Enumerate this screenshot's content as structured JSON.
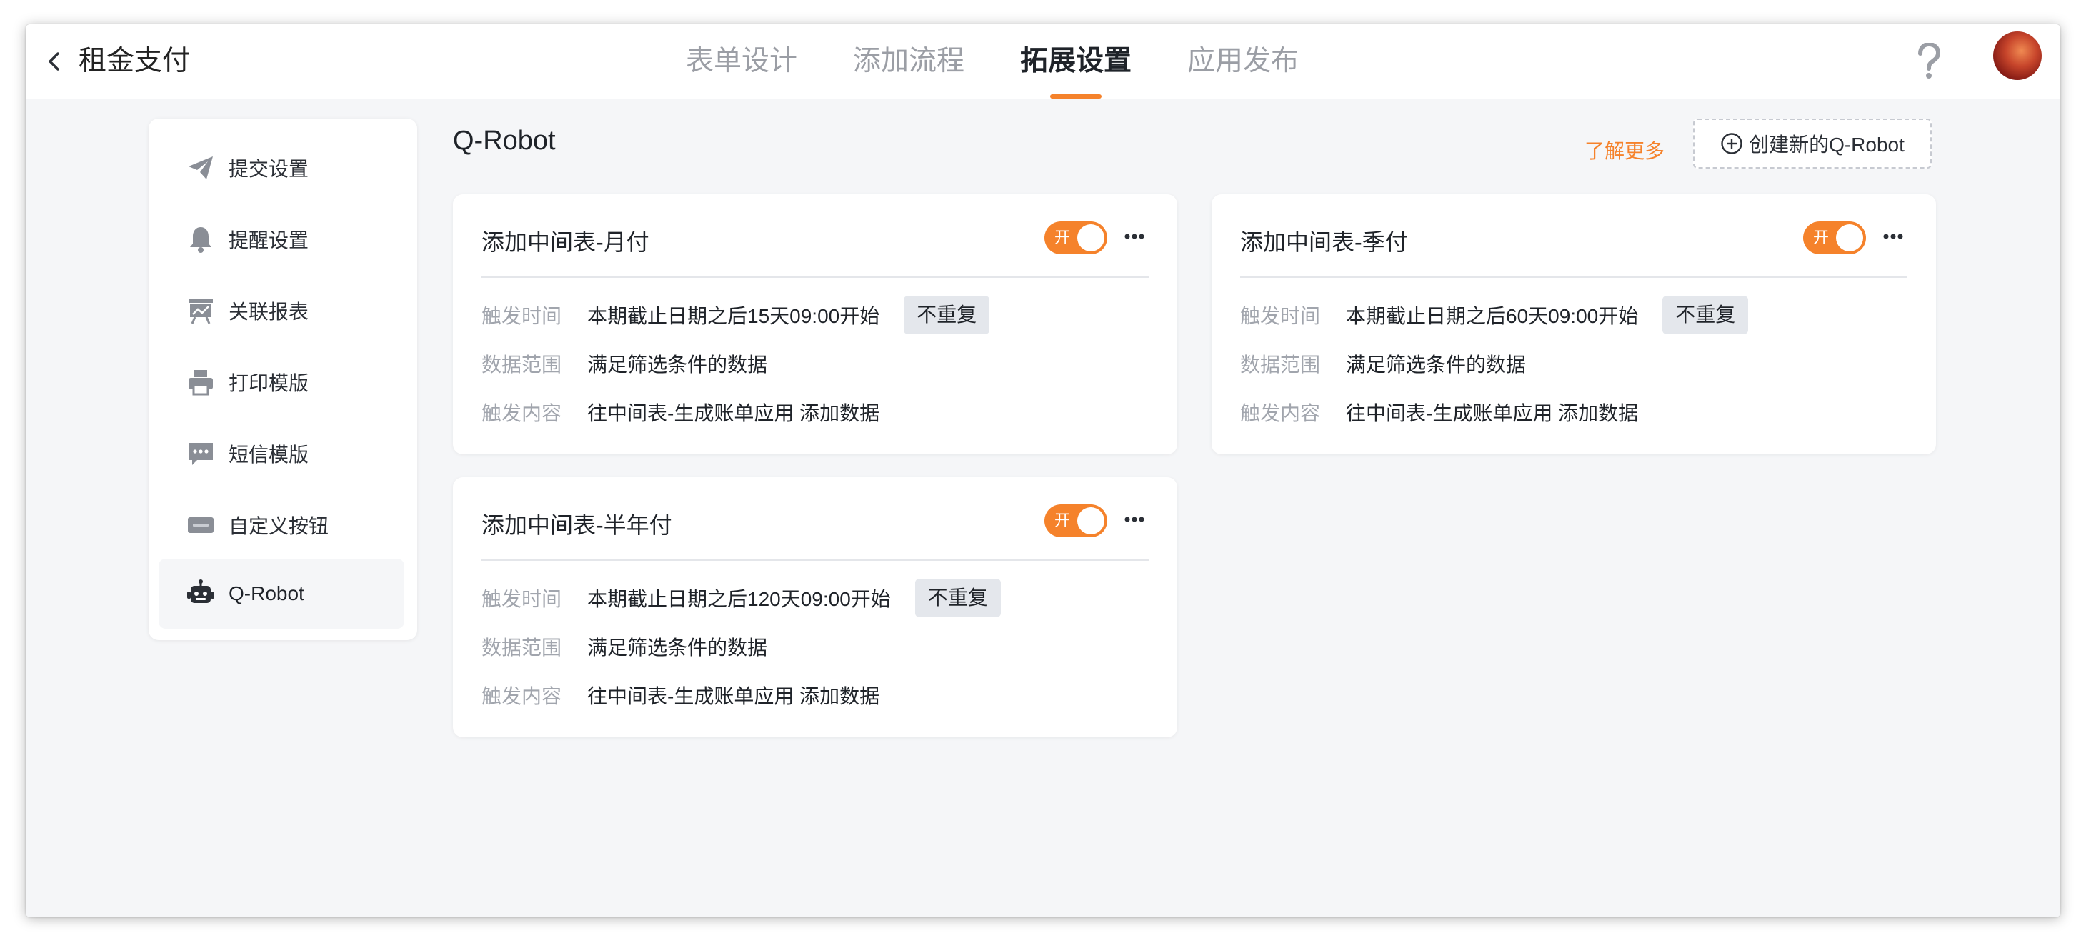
{
  "header": {
    "app_title": "租金支付",
    "tabs": [
      "表单设计",
      "添加流程",
      "拓展设置",
      "应用发布"
    ],
    "active_tab": "拓展设置"
  },
  "sidebar": {
    "items": [
      {
        "label": "提交设置",
        "icon": "paper-plane-icon"
      },
      {
        "label": "提醒设置",
        "icon": "bell-icon"
      },
      {
        "label": "关联报表",
        "icon": "chart-board-icon"
      },
      {
        "label": "打印模版",
        "icon": "printer-icon"
      },
      {
        "label": "短信模版",
        "icon": "message-icon"
      },
      {
        "label": "自定义按钮",
        "icon": "btn-icon"
      },
      {
        "label": "Q-Robot",
        "icon": "robot-icon",
        "active": true
      }
    ]
  },
  "main": {
    "title": "Q-Robot",
    "learn_more": "了解更多",
    "create_button": "创建新的Q-Robot"
  },
  "robots": [
    {
      "name": "添加中间表-月付",
      "switch_label": "开",
      "enabled": true,
      "trigger_time_label": "触发时间",
      "trigger_time": "本期截止日期之后15天09:00开始",
      "repeat": "不重复",
      "data_range_label": "数据范围",
      "data_range": "满足筛选条件的数据",
      "trigger_content_label": "触发内容",
      "trigger_content": "往中间表-生成账单应用 添加数据"
    },
    {
      "name": "添加中间表-季付",
      "switch_label": "开",
      "enabled": true,
      "trigger_time_label": "触发时间",
      "trigger_time": "本期截止日期之后60天09:00开始",
      "repeat": "不重复",
      "data_range_label": "数据范围",
      "data_range": "满足筛选条件的数据",
      "trigger_content_label": "触发内容",
      "trigger_content": "往中间表-生成账单应用 添加数据"
    },
    {
      "name": "添加中间表-半年付",
      "switch_label": "开",
      "enabled": true,
      "trigger_time_label": "触发时间",
      "trigger_time": "本期截止日期之后120天09:00开始",
      "repeat": "不重复",
      "data_range_label": "数据范围",
      "data_range": "满足筛选条件的数据",
      "trigger_content_label": "触发内容",
      "trigger_content": "往中间表-生成账单应用 添加数据"
    }
  ],
  "colors": {
    "accent": "#f5822b",
    "background": "#f5f6f8",
    "text_primary": "#1f2329",
    "text_secondary": "#a1a5ad",
    "tag_background": "#e4e7ec"
  }
}
